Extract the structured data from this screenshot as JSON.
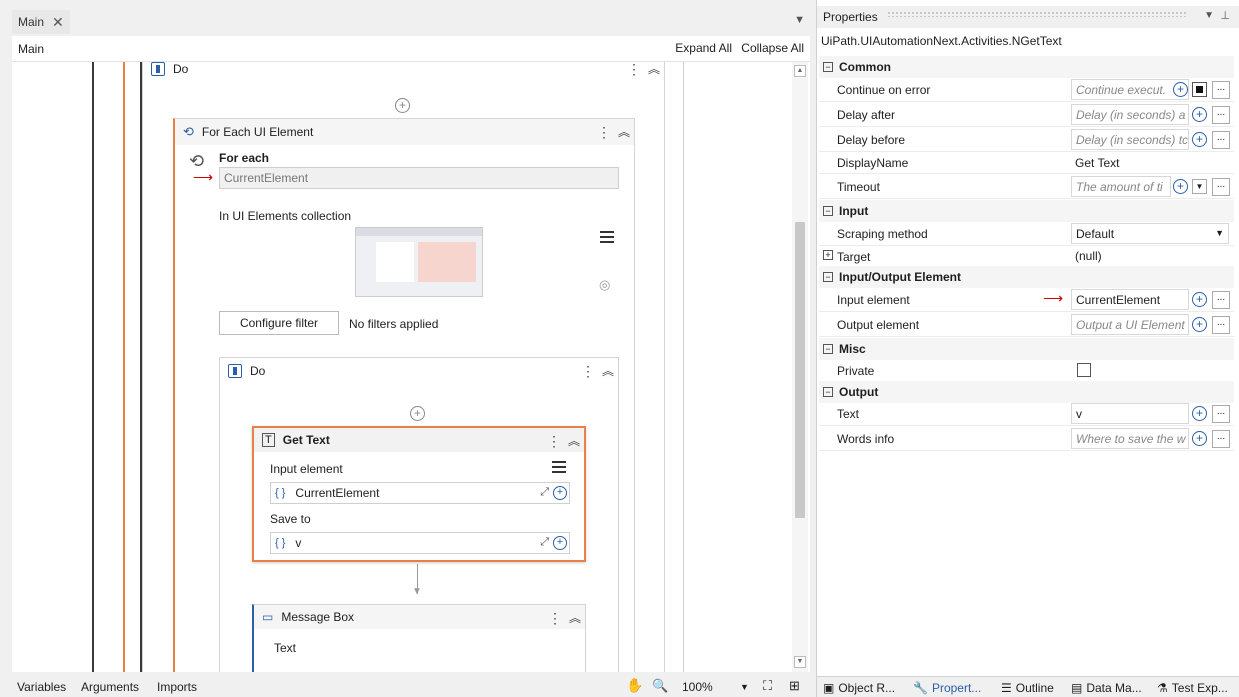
{
  "designer": {
    "tab_label": "Main",
    "breadcrumb": "Main",
    "expand_all": "Expand All",
    "collapse_all": "Collapse All",
    "outer_do": "Do",
    "for_each": {
      "title": "For Each UI Element",
      "for_each_label": "For each",
      "current_element": "CurrentElement",
      "collection_label": "In UI Elements collection",
      "configure_filter": "Configure filter",
      "no_filters": "No filters applied"
    },
    "inner_do": "Do",
    "get_text": {
      "title": "Get Text",
      "input_label": "Input element",
      "input_value": "CurrentElement",
      "save_label": "Save to",
      "save_value": "v"
    },
    "message_box": {
      "title": "Message Box",
      "text_label": "Text"
    },
    "bottom": {
      "variables": "Variables",
      "arguments": "Arguments",
      "imports": "Imports",
      "zoom": "100%"
    }
  },
  "properties": {
    "title": "Properties",
    "type_name": "UiPath.UIAutomationNext.Activities.NGetText",
    "categories": {
      "common": "Common",
      "input": "Input",
      "io": "Input/Output Element",
      "misc": "Misc",
      "output": "Output"
    },
    "rows": {
      "continue_on_error": {
        "name": "Continue on error",
        "placeholder": "Continue execut."
      },
      "delay_after": {
        "name": "Delay after",
        "placeholder": "Delay (in seconds) a"
      },
      "delay_before": {
        "name": "Delay before",
        "placeholder": "Delay (in seconds) tc"
      },
      "display_name": {
        "name": "DisplayName",
        "value": "Get Text"
      },
      "timeout": {
        "name": "Timeout",
        "placeholder": "The amount of ti"
      },
      "scraping_method": {
        "name": "Scraping method",
        "value": "Default"
      },
      "target": {
        "name": "Target",
        "value": "(null)"
      },
      "input_element": {
        "name": "Input element",
        "value": "CurrentElement"
      },
      "output_element": {
        "name": "Output element",
        "placeholder": "Output a UI Element"
      },
      "private": {
        "name": "Private"
      },
      "text": {
        "name": "Text",
        "value": "v"
      },
      "words_info": {
        "name": "Words info",
        "placeholder": "Where to save the w"
      }
    },
    "tabs": [
      "Object R...",
      "Propert...",
      "Outline",
      "Data Ma...",
      "Test Exp..."
    ]
  },
  "colors": {
    "accent": "#2b5fa8",
    "selected_activity": "#e8804a",
    "arrow": "#cc0000"
  }
}
